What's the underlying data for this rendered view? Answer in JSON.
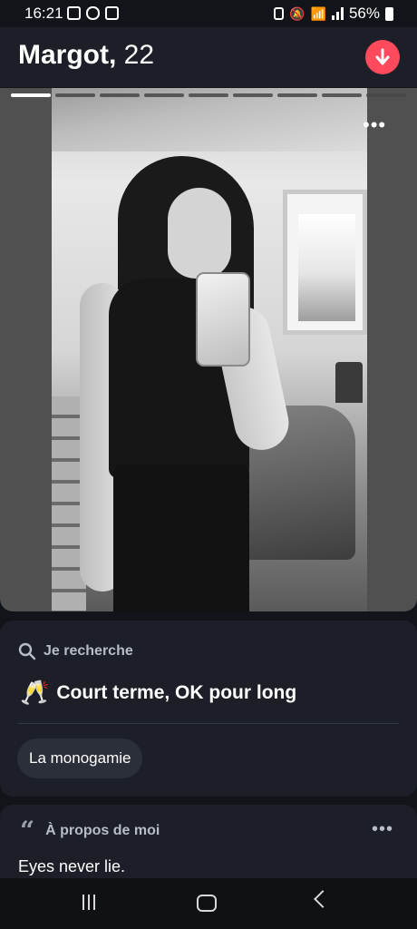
{
  "status_bar": {
    "time": "16:21",
    "battery_percent": "56%"
  },
  "header": {
    "name": "Margot,",
    "age": "22"
  },
  "photo": {
    "total_photos": 9,
    "current_photo": 1
  },
  "looking_for": {
    "label": "Je recherche",
    "emoji": "🥂",
    "value": "Court terme, OK pour long",
    "chip": "La monogamie"
  },
  "about": {
    "label": "À propos de moi",
    "bio": "Eyes never lie."
  },
  "colors": {
    "accent": "#fe4a5c",
    "card": "#1c1f27",
    "background": "#111418"
  }
}
